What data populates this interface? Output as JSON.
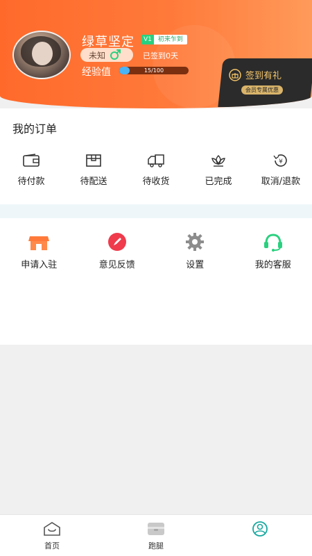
{
  "profile": {
    "username": "绿草坚定",
    "vip_level": "V1",
    "vip_title": "初来乍到",
    "gender_label": "未知",
    "signin_days": "已签到0天",
    "exp_label": "经验值",
    "exp_text": "15/100",
    "exp_progress": 0.15
  },
  "checkin": {
    "title": "签到有礼",
    "subtitle": "会员专属优惠"
  },
  "orders": {
    "title": "我的订单",
    "items": [
      {
        "label": "待付款",
        "icon": "wallet-icon"
      },
      {
        "label": "待配送",
        "icon": "package-icon"
      },
      {
        "label": "待收货",
        "icon": "truck-icon"
      },
      {
        "label": "已完成",
        "icon": "lotus-icon"
      },
      {
        "label": "取消/退款",
        "icon": "refund-icon"
      }
    ]
  },
  "tools": {
    "items": [
      {
        "label": "申请入驻",
        "icon": "shop-icon"
      },
      {
        "label": "意见反馈",
        "icon": "feedback-icon"
      },
      {
        "label": "设置",
        "icon": "gear-icon"
      },
      {
        "label": "我的客服",
        "icon": "headset-icon"
      }
    ]
  },
  "nav": {
    "items": [
      {
        "label": "首页",
        "icon": "home-icon"
      },
      {
        "label": "跑腿",
        "icon": "errand-icon"
      },
      {
        "label": "",
        "icon": "profile-icon"
      }
    ]
  },
  "colors": {
    "header_orange": "#ff6a2b",
    "accent_green": "#2ad07f",
    "gold": "#f4c56a"
  }
}
